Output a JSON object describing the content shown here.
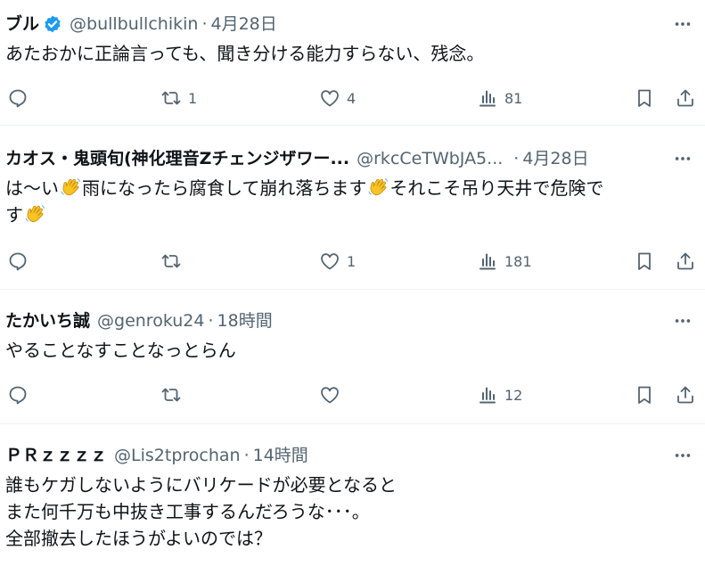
{
  "tweets": [
    {
      "name": "ブル",
      "verified": true,
      "handle": "@bullbullchikin",
      "dot": "·",
      "time": "4月28日",
      "lines": [
        "あたおかに正論言っても、聞き分ける能力すらない、残念。"
      ],
      "retweets": "1",
      "likes": "4",
      "views": "81"
    },
    {
      "name": "カオス・鬼頭旬(神化理音Zチェンジザワー...",
      "verified": false,
      "handle": "@rkcCeTWbJA5...",
      "dot": "·",
      "time": "4月28日",
      "lines": [
        "は～い",
        "雨になったら腐食して崩れ落ちます",
        "それこそ吊り天井で危険で",
        "す"
      ],
      "retweets": "",
      "likes": "1",
      "views": "181"
    },
    {
      "name": "たかいち誠",
      "verified": false,
      "handle": "@genroku24",
      "dot": "·",
      "time": "18時間",
      "lines": [
        "やることなすことなっとらん"
      ],
      "retweets": "",
      "likes": "",
      "views": "12"
    },
    {
      "name": "ＰＲｚｚｚｚ",
      "verified": false,
      "handle": "@Lis2tprochan",
      "dot": "·",
      "time": "14時間",
      "lines": [
        "誰もケガしないようにバリケードが必要となると",
        "また何千万も中抜き工事するんだろうな･･･。",
        "全部撤去したほうがよいのでは？"
      ],
      "retweets": "",
      "likes": "",
      "views": ""
    }
  ],
  "icons": {
    "more": "more-dots-icon",
    "reply": "reply-bubble-icon",
    "retweet": "retweet-icon",
    "like": "heart-icon",
    "views": "views-bar-chart-icon",
    "bookmark": "bookmark-icon",
    "share": "share-icon",
    "verified": "verified-badge-icon",
    "emoji": "waving-hand-emoji"
  },
  "colors": {
    "text": "#0f1419",
    "secondary": "#536471",
    "verified": "#1d9bf0",
    "divider": "#eff3f4",
    "emoji": "#f7c325"
  }
}
